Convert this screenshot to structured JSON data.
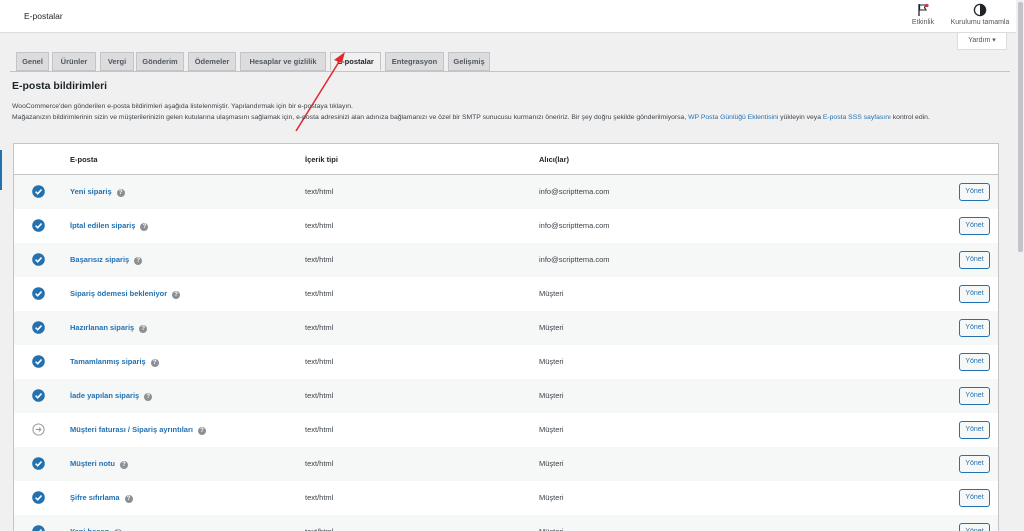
{
  "topbar": {
    "title": "E-postalar",
    "activity_label": "Etkinlik",
    "setup_label": "Kurulumu tamamla"
  },
  "help_tab": {
    "label": "Yardım ▾"
  },
  "tabs": [
    {
      "label": "Genel"
    },
    {
      "label": "Ürünler"
    },
    {
      "label": "Vergi"
    },
    {
      "label": "Gönderim"
    },
    {
      "label": "Ödemeler"
    },
    {
      "label": "Hesaplar ve gizlilik"
    },
    {
      "label": "E-postalar"
    },
    {
      "label": "Entegrasyon"
    },
    {
      "label": "Gelişmiş"
    }
  ],
  "active_tab": "E-postalar",
  "section": {
    "title": "E-posta bildirimleri",
    "line1": "WooCommerce'den gönderilen e-posta bildirimleri aşağıda listelenmiştir. Yapılandırmak için bir e-postaya tıklayın.",
    "line2_a": "Mağazanızın bildirimlerinin sizin ve müşterilerinizin gelen kutularına ulaşmasını sağlamak için, e-posta adresinizi alan adınıza bağlamanızı ve özel bir SMTP sunucusu kurmanızı öneririz. Bir şey doğru şekilde gönderilmiyorsa, ",
    "link1": "WP Posta Günlüğü Eklentisini",
    "line2_b": " yükleyin veya ",
    "link2": "E-posta SSS sayfasını",
    "line2_c": " kontrol edin."
  },
  "table": {
    "headers": {
      "email": "E-posta",
      "content_type": "İçerik tipi",
      "recipients": "Alıcı(lar)"
    },
    "rows": [
      {
        "name": "Yeni sipariş",
        "content_type": "text/html",
        "recipient": "info@scripttema.com",
        "enabled": true,
        "action": "Yönet"
      },
      {
        "name": "İptal edilen sipariş",
        "content_type": "text/html",
        "recipient": "info@scripttema.com",
        "enabled": true,
        "action": "Yönet"
      },
      {
        "name": "Başarısız sipariş",
        "content_type": "text/html",
        "recipient": "info@scripttema.com",
        "enabled": true,
        "action": "Yönet"
      },
      {
        "name": "Sipariş ödemesi bekleniyor",
        "content_type": "text/html",
        "recipient": "Müşteri",
        "enabled": true,
        "action": "Yönet"
      },
      {
        "name": "Hazırlanan sipariş",
        "content_type": "text/html",
        "recipient": "Müşteri",
        "enabled": true,
        "action": "Yönet"
      },
      {
        "name": "Tamamlanmış sipariş",
        "content_type": "text/html",
        "recipient": "Müşteri",
        "enabled": true,
        "action": "Yönet"
      },
      {
        "name": "İade yapılan sipariş",
        "content_type": "text/html",
        "recipient": "Müşteri",
        "enabled": true,
        "action": "Yönet"
      },
      {
        "name": "Müşteri faturası / Sipariş ayrıntıları",
        "content_type": "text/html",
        "recipient": "Müşteri",
        "enabled": false,
        "action": "Yönet"
      },
      {
        "name": "Müşteri notu",
        "content_type": "text/html",
        "recipient": "Müşteri",
        "enabled": true,
        "action": "Yönet"
      },
      {
        "name": "Şifre sıfırlama",
        "content_type": "text/html",
        "recipient": "Müşteri",
        "enabled": true,
        "action": "Yönet"
      },
      {
        "name": "Yeni hesap",
        "content_type": "text/html",
        "recipient": "Müşteri",
        "enabled": true,
        "action": "Yönet"
      }
    ]
  },
  "colors": {
    "accent": "#2271b1",
    "annotation_arrow": "#e0282e"
  }
}
